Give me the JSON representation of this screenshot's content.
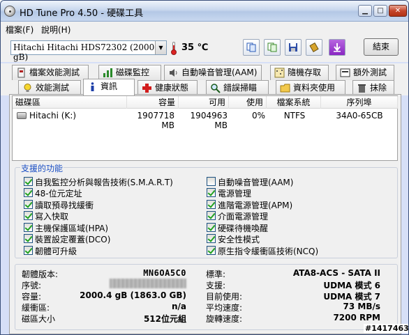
{
  "window": {
    "title": "HD Tune Pro 4.50 - 硬碟工具"
  },
  "menu": {
    "file": "檔案(F)",
    "help": "說明(H)"
  },
  "toolbar": {
    "drive": "Hitachi Hitachi HDS72302 (2000 gB)",
    "temperature": "35 ℃",
    "exit_label": "結束",
    "colors": {
      "accent": "#1b4fc4"
    }
  },
  "tabs_row1": [
    "檔案效能測試",
    "磁碟監控",
    "自動噪音管理(AAM)",
    "隨機存取",
    "額外測試"
  ],
  "tabs_row2": [
    "效能測試",
    "資訊",
    "健康狀態",
    "錯誤掃瞄",
    "資料夾使用",
    "抹除"
  ],
  "active_tab": "資訊",
  "partitions": {
    "headers": [
      "磁碟區",
      "容量",
      "可用",
      "使用",
      "檔案系統",
      "序列埠"
    ],
    "rows": [
      {
        "volume": "Hitachi (K:)",
        "capacity": "1907718 MB",
        "free": "1904963 MB",
        "used": "0%",
        "fs": "NTFS",
        "serial": "34A0-65CB"
      }
    ]
  },
  "features": {
    "title": "支援的功能",
    "left": [
      {
        "label": "自我監控分析與報告技術(S.M.A.R.T)",
        "checked": true
      },
      {
        "label": "48-位元定址",
        "checked": true
      },
      {
        "label": "讀取預尋找緩衝",
        "checked": true
      },
      {
        "label": "寫入快取",
        "checked": true
      },
      {
        "label": "主機保護區域(HPA)",
        "checked": true
      },
      {
        "label": "裝置設定覆蓋(DCO)",
        "checked": true
      },
      {
        "label": "韌體可升級",
        "checked": true
      }
    ],
    "right": [
      {
        "label": "自動噪音管理(AAM)",
        "checked": false
      },
      {
        "label": "電源管理",
        "checked": true
      },
      {
        "label": "進階電源管理(APM)",
        "checked": true
      },
      {
        "label": "介面電源管理",
        "checked": true
      },
      {
        "label": "硬碟待機喚醒",
        "checked": true
      },
      {
        "label": "安全性模式",
        "checked": true
      },
      {
        "label": "原生指令緩衝區技術(NCQ)",
        "checked": true
      }
    ]
  },
  "info_left": [
    {
      "label": "韌體版本:",
      "value": "MN6OA5C0"
    },
    {
      "label": "序號:",
      "value": ""
    },
    {
      "label": "容量:",
      "value": "2000.4 gB (1863.0 GB)"
    },
    {
      "label": "緩衝區:",
      "value": "n/a"
    },
    {
      "label": "磁區大小",
      "value": "512位元組"
    }
  ],
  "info_right": [
    {
      "label": "標準:",
      "value": "ATA8-ACS - SATA II"
    },
    {
      "label": "支援:",
      "value": "UDMA 模式 6"
    },
    {
      "label": "目前使用:",
      "value": "UDMA 模式 7"
    },
    {
      "label": "平均速度:",
      "value": "73 MB/s"
    },
    {
      "label": "旋轉速度:",
      "value": "7200 RPM"
    }
  ],
  "watermark": "#1417463"
}
